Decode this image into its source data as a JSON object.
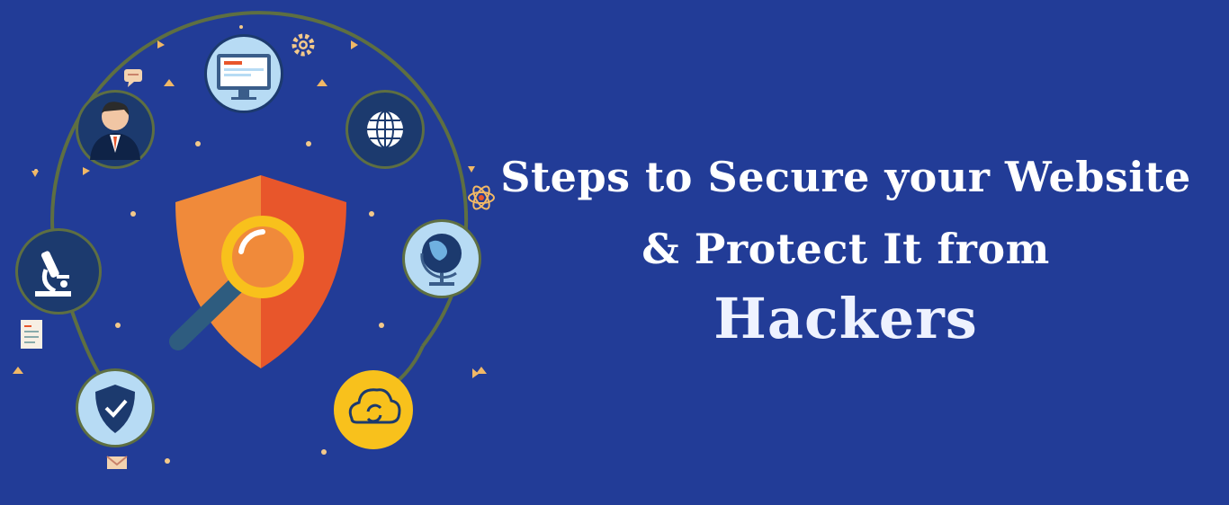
{
  "banner": {
    "line1": "Steps to Secure your Website",
    "line2": "& Protect It from",
    "line3": "Hackers"
  },
  "colors": {
    "background": "#223c97",
    "shield_left": "#f08a3a",
    "shield_right": "#e8562b",
    "magnifier_ring": "#f8c11c",
    "circle_fill": "#9cc6e8",
    "circle_dark": "#1c3a6e",
    "arc": "#5e6f42",
    "cloud_circle": "#f8c11c"
  },
  "icons": [
    "person-icon",
    "monitor-icon",
    "globe-grid-icon",
    "globe-stand-icon",
    "cloud-sync-icon",
    "shield-check-icon",
    "microscope-icon",
    "gear-icon",
    "atom-icon",
    "chat-bubble-icon",
    "document-icon",
    "mail-icon",
    "shield-magnifier-icon"
  ]
}
